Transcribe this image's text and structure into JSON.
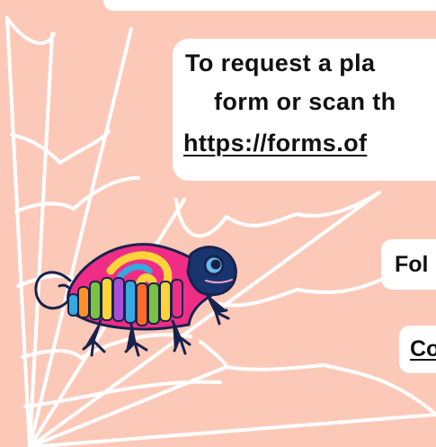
{
  "colors": {
    "background": "#fcc9b9",
    "panel": "#ffffff",
    "text": "#111111",
    "web": "#ffffff",
    "chameleon_dark": "#1e2f66",
    "chameleon_pink": "#ef2d86",
    "chameleon_yellow": "#ffd33a"
  },
  "icons": {
    "spider_web": "spider-web",
    "chameleon": "chameleon"
  },
  "content": {
    "request_lines": [
      "To request a pla",
      "form or scan th",
      "https://forms.of"
    ],
    "follow_text": "Fol",
    "contact_text": "Co"
  }
}
